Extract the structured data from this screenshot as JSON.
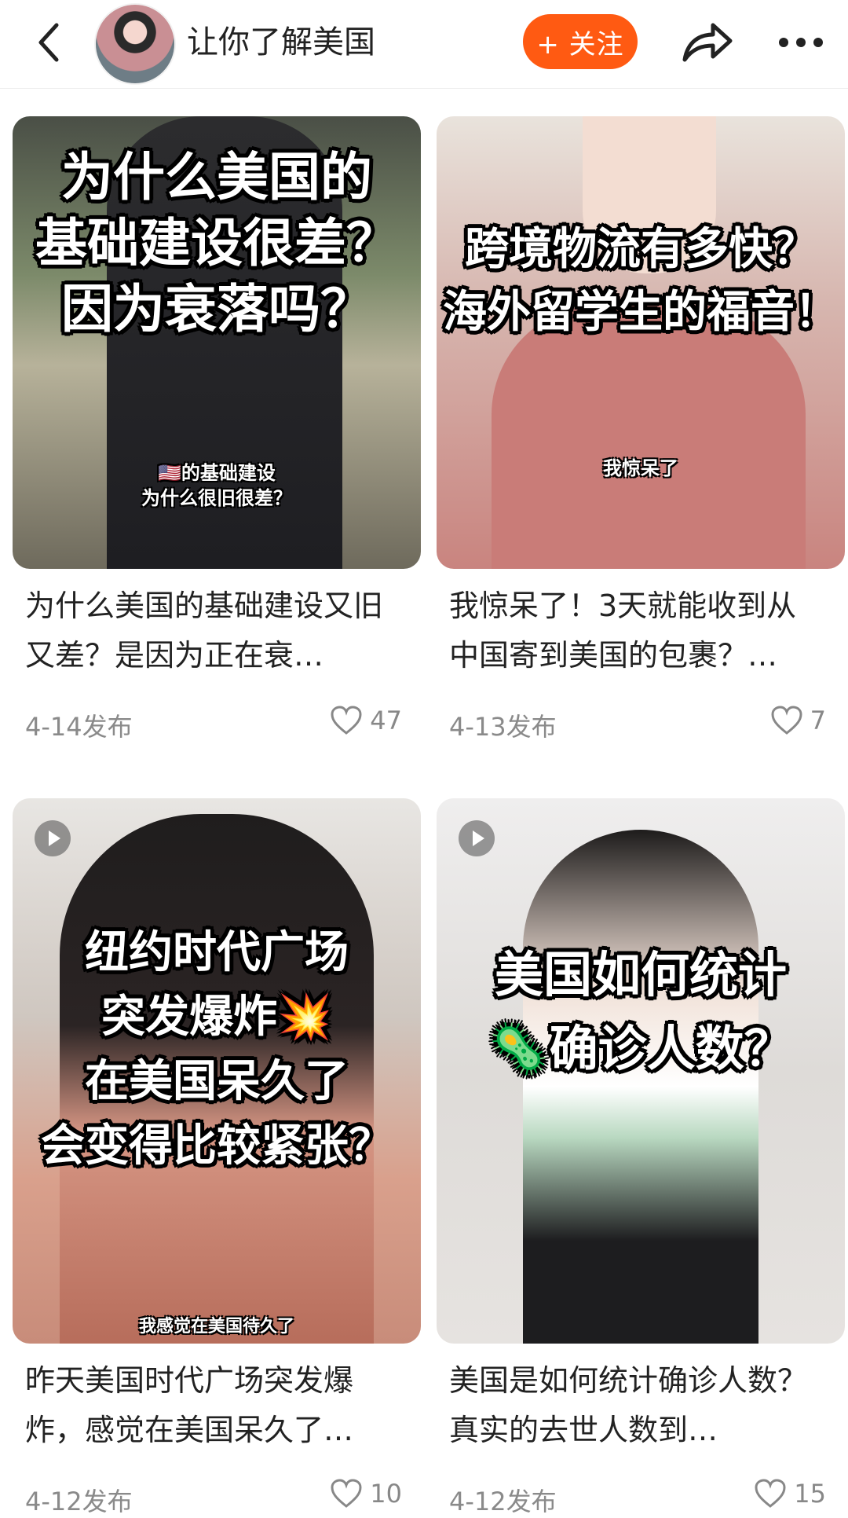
{
  "header": {
    "title": "让你了解美国",
    "follow_label": "+ 关注"
  },
  "cards": [
    {
      "overlay": "为什么美国的\n基础建设很差？\n因为衰落吗？",
      "subtitle": "🇺🇸的基础建设\n为什么很旧很差？",
      "caption": "为什么美国的基础建设又旧又差？是因为正在衰…",
      "date": "4-14发布",
      "likes": "47",
      "is_video": false
    },
    {
      "overlay": "跨境物流有多快？\n海外留学生的福音！",
      "subtitle": "我惊呆了",
      "caption": "我惊呆了！3天就能收到从中国寄到美国的包裹？…",
      "date": "4-13发布",
      "likes": "7",
      "is_video": false
    },
    {
      "overlay": "纽约时代广场\n突发爆炸💥\n在美国呆久了\n会变得比较紧张？",
      "subtitle": "我感觉在美国待久了",
      "caption": "昨天美国时代广场突发爆炸，感觉在美国呆久了…",
      "date": "4-12发布",
      "likes": "10",
      "is_video": true
    },
    {
      "overlay": "美国如何统计\n🦠确诊人数？",
      "subtitle": "",
      "caption": "美国是如何统计确诊人数？真实的去世人数到…",
      "date": "4-12发布",
      "likes": "15",
      "is_video": true
    }
  ],
  "colors": {
    "accent": "#ff5a12",
    "meta_text": "#8a8a8a"
  },
  "icons": [
    "back-arrow-icon",
    "share-icon",
    "more-dots-icon",
    "heart-icon",
    "play-icon"
  ]
}
